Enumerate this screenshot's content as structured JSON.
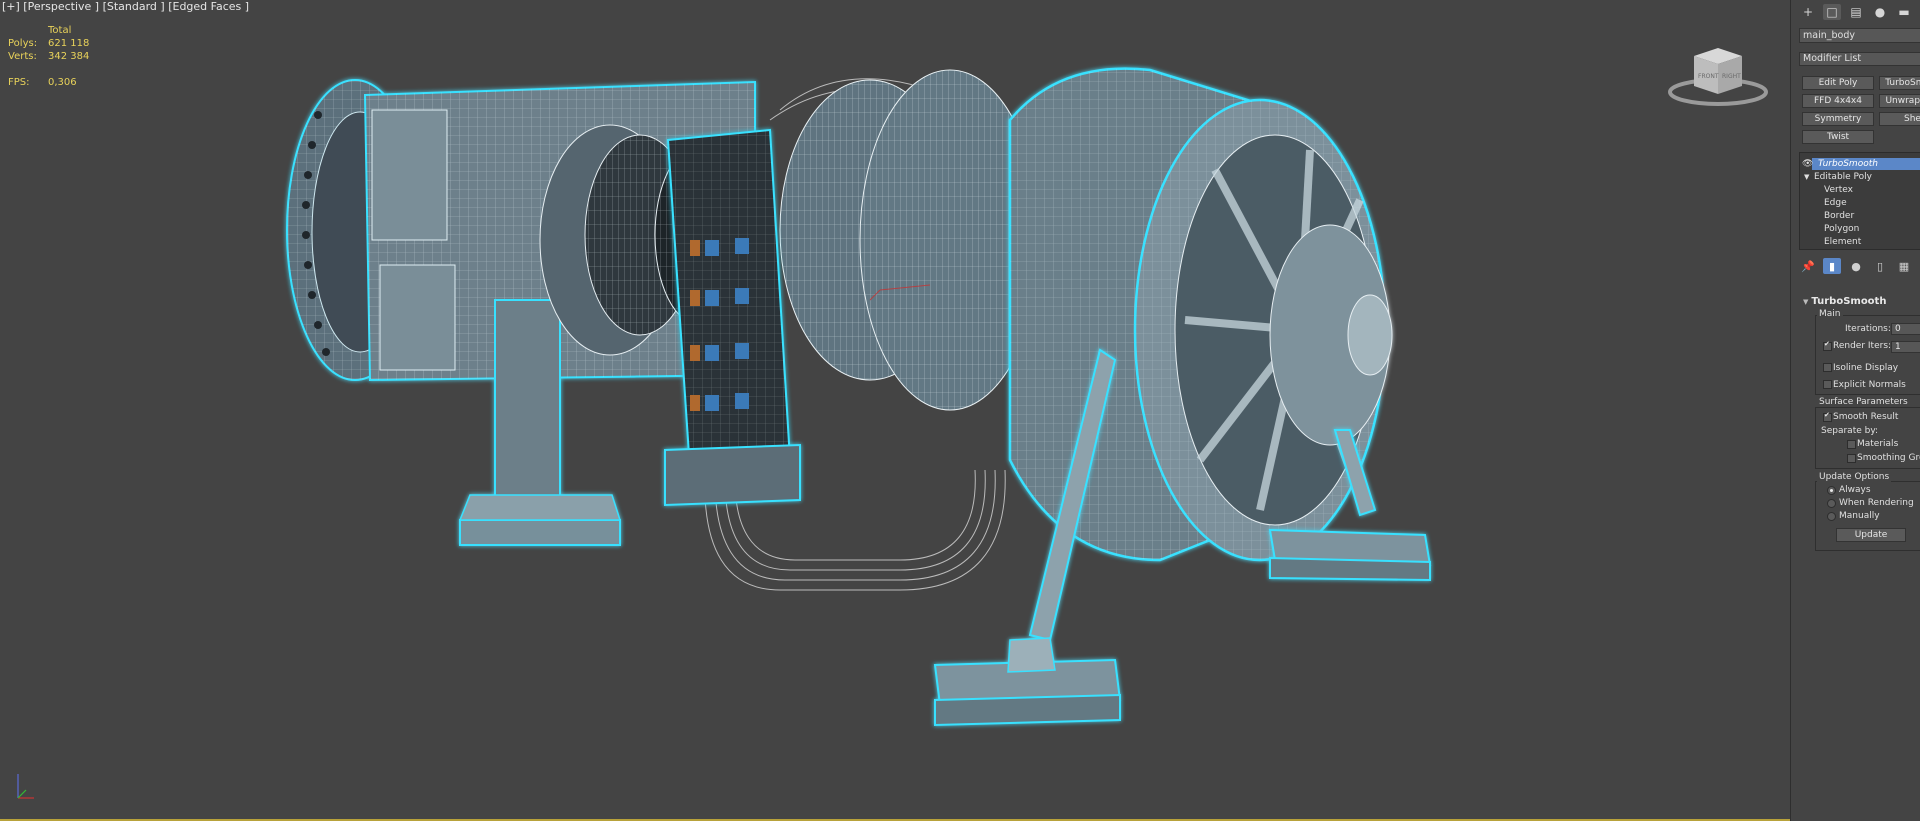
{
  "viewport": {
    "label": "[+] [Perspective ] [Standard ] [Edged Faces ]",
    "stats": {
      "header": "Total",
      "polys_label": "Polys:",
      "polys_value": "621 118",
      "verts_label": "Verts:",
      "verts_value": "342 384",
      "fps_label": "FPS:",
      "fps_value": "0,306"
    },
    "viewcube": {
      "front_label": "FRONT",
      "right_label": "RIGHT"
    },
    "colors": {
      "background": "#444444",
      "selection_outline": "#39e1ff",
      "mesh": "#7f98a6",
      "stats_text": "#e8d25a"
    }
  },
  "command_panel": {
    "tabs": [
      "create-icon",
      "modify-icon",
      "hierarchy-icon",
      "motion-icon",
      "display-icon"
    ],
    "object_name": "main_body",
    "modifier_list_label": "Modifier List",
    "modifier_buttons": [
      "Edit Poly",
      "TurboSmooth",
      "FFD 4x4x4",
      "Unwrap UVW",
      "Symmetry",
      "Shell",
      "Twist"
    ],
    "stack": {
      "turbosmooth": "TurboSmooth",
      "editable_poly": "Editable Poly",
      "sub_objects": [
        "Vertex",
        "Edge",
        "Border",
        "Polygon",
        "Element"
      ]
    },
    "stack_tools": [
      "pin-icon",
      "show-end-result-icon",
      "make-unique-icon",
      "remove-modifier-icon",
      "configure-icon"
    ],
    "rollout": {
      "title": "TurboSmooth",
      "main_group": "Main",
      "iterations_label": "Iterations:",
      "iterations_value": "0",
      "render_iters_label": "Render Iters:",
      "render_iters_value": "1",
      "render_iters_checked": true,
      "isoline_display_label": "Isoline Display",
      "isoline_display_checked": false,
      "explicit_normals_label": "Explicit Normals",
      "explicit_normals_checked": false,
      "surface_group": "Surface Parameters",
      "smooth_result_label": "Smooth Result",
      "smooth_result_checked": true,
      "separate_by_label": "Separate by:",
      "materials_label": "Materials",
      "materials_checked": false,
      "smoothing_groups_label": "Smoothing Groups",
      "smoothing_groups_checked": false,
      "update_group": "Update Options",
      "always_label": "Always",
      "when_rendering_label": "When Rendering",
      "manually_label": "Manually",
      "update_mode": "Always",
      "update_button": "Update"
    }
  }
}
